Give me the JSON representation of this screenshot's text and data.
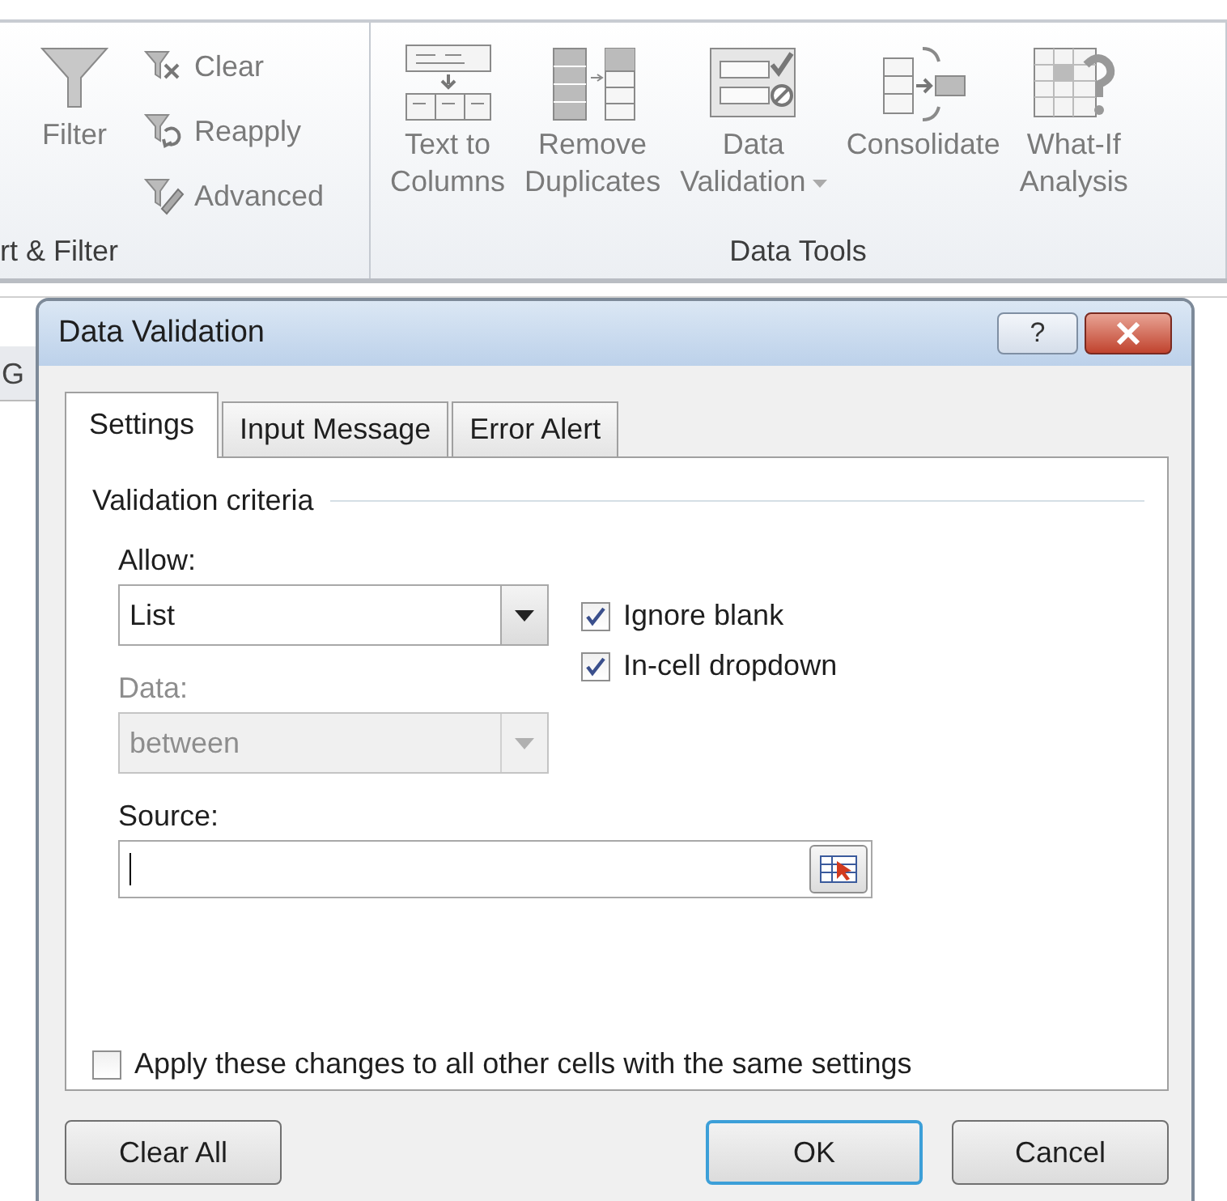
{
  "ribbon": {
    "groups": [
      {
        "label": "rt & Filter",
        "large_buttons": [
          {
            "lines": [
              "Filter"
            ],
            "has_menu": false
          }
        ],
        "small_buttons": [
          {
            "label": "Clear"
          },
          {
            "label": "Reapply"
          },
          {
            "label": "Advanced"
          }
        ]
      },
      {
        "label": "Data Tools",
        "large_buttons": [
          {
            "lines": [
              "Text to",
              "Columns"
            ],
            "has_menu": false
          },
          {
            "lines": [
              "Remove",
              "Duplicates"
            ],
            "has_menu": false
          },
          {
            "lines": [
              "Data",
              "Validation"
            ],
            "has_menu": true
          },
          {
            "lines": [
              "Consolidate"
            ],
            "has_menu": false
          },
          {
            "lines": [
              "What-If",
              "Analysis"
            ],
            "has_menu": false
          }
        ]
      }
    ]
  },
  "sheet": {
    "column_header": "G"
  },
  "dialog": {
    "title": "Data Validation",
    "help_button": "?",
    "tabs": [
      {
        "label": "Settings",
        "selected": true
      },
      {
        "label": "Input Message",
        "selected": false
      },
      {
        "label": "Error Alert",
        "selected": false
      }
    ],
    "group_label": "Validation criteria",
    "allow": {
      "label": "Allow:",
      "value": "List",
      "disabled": false
    },
    "data": {
      "label": "Data:",
      "value": "between",
      "disabled": true
    },
    "checkboxes": [
      {
        "label": "Ignore blank",
        "checked": true
      },
      {
        "label": "In-cell dropdown",
        "checked": true
      }
    ],
    "source": {
      "label": "Source:"
    },
    "apply_checkbox": {
      "label": "Apply these changes to all other cells with the same settings",
      "checked": false
    },
    "buttons": [
      {
        "label": "Clear All",
        "default": false
      },
      {
        "label": "OK",
        "default": true
      },
      {
        "label": "Cancel",
        "default": false
      }
    ]
  }
}
